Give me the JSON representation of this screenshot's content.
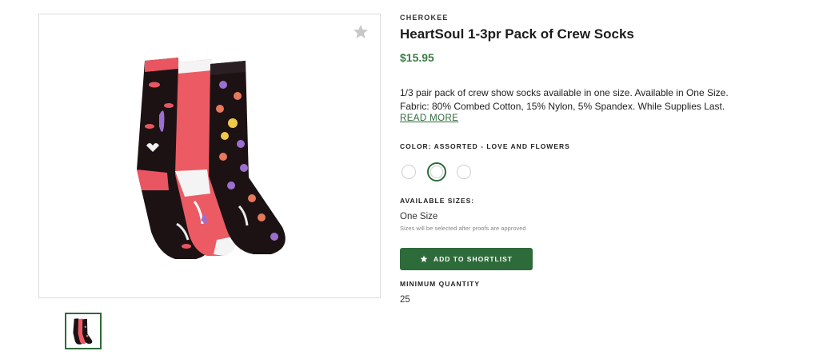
{
  "product": {
    "brand": "CHEROKEE",
    "title": "HeartSoul 1-3pr Pack of Crew Socks",
    "price": "$15.95",
    "description": "1/3 pair pack of crew show socks available in one size. Available in One Size. Fabric: 80% Combed Cotton, 15% Nylon, 5% Spandex. While Supplies Last.",
    "read_more": "READ MORE",
    "color_label": "COLOR: ASSORTED - LOVE AND FLOWERS",
    "swatches": [
      {
        "color": "#ffffff",
        "selected": false
      },
      {
        "color": "#ffffff",
        "selected": true
      },
      {
        "color": "#ffffff",
        "selected": false
      }
    ],
    "sizes_label": "AVAILABLE SIZES:",
    "size_value": "One Size",
    "size_note": "Sizes will be selected after proofs are approved",
    "add_button": "ADD TO SHORTLIST",
    "min_qty_label": "MINIMUM QUANTITY",
    "min_qty_value": "25"
  },
  "icons": {
    "favorite": "star-icon",
    "add_button": "star-icon"
  },
  "colors": {
    "accent": "#2e6b3a",
    "price": "#3b7d45"
  }
}
